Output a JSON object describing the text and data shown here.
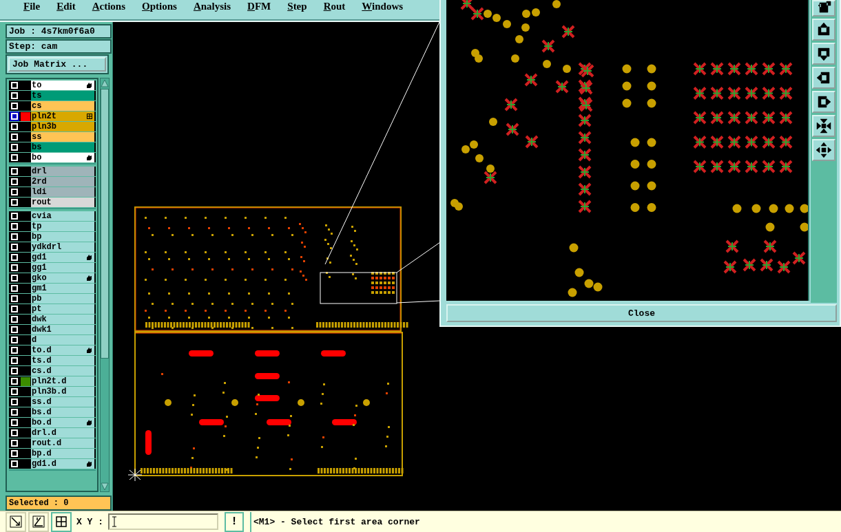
{
  "menu": [
    "File",
    "Edit",
    "Actions",
    "Options",
    "Analysis",
    "DFM",
    "Step",
    "Rout",
    "Windows"
  ],
  "job": "Job : 4s7km0f6a0",
  "step": "Step: cam",
  "job_matrix_button": "Job Matrix ...",
  "layer_groups": [
    {
      "layers": [
        {
          "name": "to",
          "color": "#ffffff",
          "selected": false,
          "hand_mark": true
        },
        {
          "name": "ts",
          "color": "#009b77",
          "selected": false
        },
        {
          "name": "cs",
          "color": "#ffc455",
          "selected": false
        },
        {
          "name": "pln2t",
          "color": "#d8a800",
          "selected": true,
          "swatch": {
            "color": "#ff0000"
          },
          "grid_mark": true
        },
        {
          "name": "pln3b",
          "color": "#d8a800",
          "selected": false
        },
        {
          "name": "ss",
          "color": "#ffc455",
          "selected": false
        },
        {
          "name": "bs",
          "color": "#009b77",
          "selected": false
        },
        {
          "name": "bo",
          "color": "#ffffff",
          "selected": false,
          "hand_mark": true
        }
      ]
    },
    {
      "layers": [
        {
          "name": "drl",
          "color": "#9fb4b9",
          "selected": false
        },
        {
          "name": "2rd",
          "color": "#9fb4b9",
          "selected": false
        },
        {
          "name": "ldi",
          "color": "#9fb4b9",
          "selected": false
        },
        {
          "name": "rout",
          "color": "#d8d8d8",
          "selected": false
        }
      ]
    },
    {
      "layers": [
        {
          "name": "cvia",
          "color": "#a0dcd8",
          "selected": false
        },
        {
          "name": "tp",
          "color": "#a0dcd8",
          "selected": false
        },
        {
          "name": "bp",
          "color": "#a0dcd8",
          "selected": false
        },
        {
          "name": "ydkdrl",
          "color": "#a0dcd8",
          "selected": false
        },
        {
          "name": "gd1",
          "color": "#a0dcd8",
          "selected": false,
          "hand_mark": true
        },
        {
          "name": "gg1",
          "color": "#a0dcd8",
          "selected": false
        },
        {
          "name": "gko",
          "color": "#a0dcd8",
          "selected": false,
          "hand_mark": true
        },
        {
          "name": "gm1",
          "color": "#a0dcd8",
          "selected": false
        },
        {
          "name": "pb",
          "color": "#a0dcd8",
          "selected": false
        },
        {
          "name": "pt",
          "color": "#a0dcd8",
          "selected": false
        },
        {
          "name": "dwk",
          "color": "#a0dcd8",
          "selected": false
        },
        {
          "name": "dwk1",
          "color": "#a0dcd8",
          "selected": false
        },
        {
          "name": "d",
          "color": "#a0dcd8",
          "selected": false
        },
        {
          "name": "to.d",
          "color": "#a0dcd8",
          "selected": false,
          "hand_mark": true
        },
        {
          "name": "ts.d",
          "color": "#a0dcd8",
          "selected": false
        },
        {
          "name": "cs.d",
          "color": "#a0dcd8",
          "selected": false
        },
        {
          "name": "pln2t.d",
          "color": "#a0dcd8",
          "selected": false,
          "swatch": {
            "color": "#3c8c00"
          }
        },
        {
          "name": "pln3b.d",
          "color": "#a0dcd8",
          "selected": false
        },
        {
          "name": "ss.d",
          "color": "#a0dcd8",
          "selected": false
        },
        {
          "name": "bs.d",
          "color": "#a0dcd8",
          "selected": false
        },
        {
          "name": "bo.d",
          "color": "#a0dcd8",
          "selected": false,
          "hand_mark": true
        },
        {
          "name": "drl.d",
          "color": "#a0dcd8",
          "selected": false
        },
        {
          "name": "rout.d",
          "color": "#a0dcd8",
          "selected": false
        },
        {
          "name": "bp.d",
          "color": "#a0dcd8",
          "selected": false
        },
        {
          "name": "gd1.d",
          "color": "#a0dcd8",
          "selected": false,
          "hand_mark": true
        }
      ]
    }
  ],
  "selected_count": "Selected : 0",
  "bottom_bar": {
    "coord_label": "X Y :",
    "alert_button": "!",
    "message": "<M1> - Select first area corner"
  },
  "zoom_window": {
    "close_button": "Close"
  }
}
